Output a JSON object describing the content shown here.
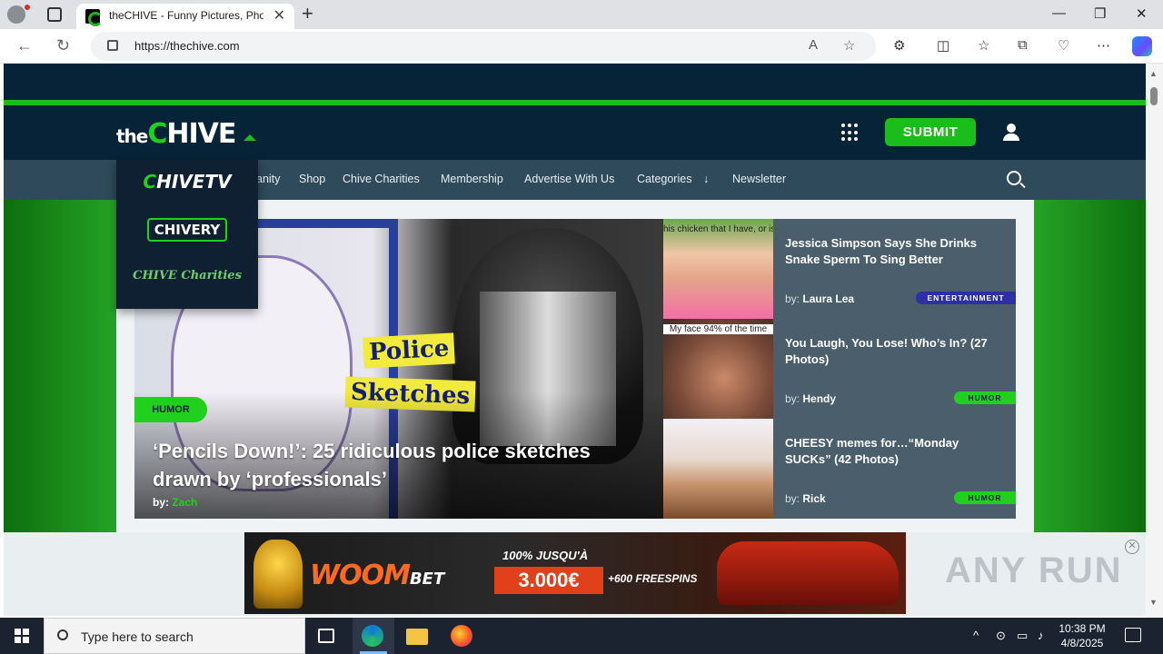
{
  "browser": {
    "tab_title": "theCHIVE - Funny Pictures, Photos",
    "tab_close": "✕",
    "new_tab": "+",
    "url": "https://thechive.com",
    "win_minimize": "—",
    "win_restore": "❐",
    "win_close": "✕"
  },
  "site": {
    "logo_the": "the",
    "logo_c": "C",
    "logo_hive": "HIVE",
    "submit_label": "SUBMIT",
    "nav": [
      "anity",
      "Shop",
      "Chive Charities",
      "Membership",
      "Advertise With Us",
      "Categories",
      "Newsletter"
    ],
    "categories_arrow": "↓",
    "dropdown": {
      "tv_c": "C",
      "tv_rest": "HIVETV",
      "chivery": "CHIVERY",
      "charities": "CHIVE Charities"
    },
    "accent_green": "#1bbd1b",
    "navy": "#072337"
  },
  "hero": {
    "category": "HUMOR",
    "sign_line1": "Police",
    "sign_line2": "Sketches",
    "headline": "‘Pencils Down!’: 25 ridiculous police sketches drawn by ‘professionals’",
    "by_label": "by:",
    "author": "Zach"
  },
  "side_articles": [
    {
      "thumb_caption": "his chicken that I have, or is it snake?",
      "title": "Jessica Simpson Says She Drinks Snake Sperm To Sing Better",
      "by_label": "by:",
      "author": "Laura Lea",
      "tag": "ENTERTAINMENT"
    },
    {
      "thumb_caption": "My face 94% of the time",
      "title": "You Laugh, You Lose! Who’s In? (27 Photos)",
      "by_label": "by:",
      "author": "Hendy",
      "tag": "HUMOR"
    },
    {
      "thumb_caption": "",
      "title": "CHEESY memes for…“Monday SUCKs” (42 Photos)",
      "by_label": "by:",
      "author": "Rick",
      "tag": "HUMOR"
    }
  ],
  "ad": {
    "brand": "WOOM",
    "brand_suffix": "BET",
    "promo_line": "100% JUSQU'À",
    "amount": "3.000€",
    "spins": "+600 FREESPINS",
    "close": "✕"
  },
  "watermark": "ANY RUN",
  "taskbar": {
    "search_placeholder": "Type here to search",
    "time": "10:38 PM",
    "date": "4/8/2025"
  }
}
